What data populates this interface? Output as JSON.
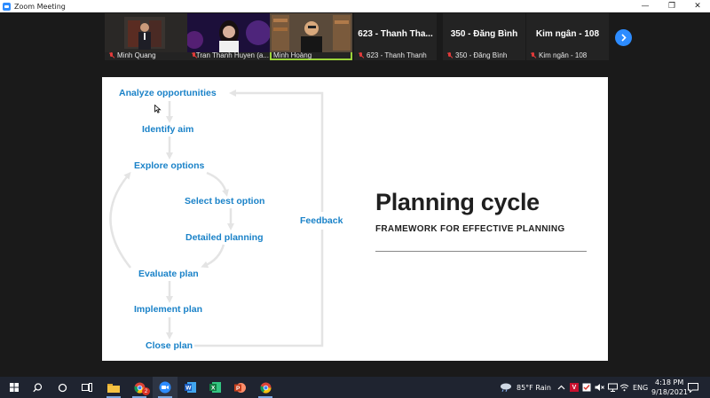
{
  "window": {
    "title": "Zoom Meeting",
    "minimize_glyph": "—",
    "maximize_glyph": "❐",
    "close_glyph": "✕"
  },
  "participants": [
    {
      "name": "Minh Quang",
      "muted": true
    },
    {
      "name": "Tran Thanh Huyen (a...",
      "muted": true
    },
    {
      "name": "Minh Hoàng",
      "muted": false,
      "active_speaker": true
    },
    {
      "name": "623 - Thanh Thanh",
      "muted": true,
      "display": "623 - Thanh Tha..."
    },
    {
      "name": "350 - Đăng Bình",
      "muted": true,
      "display": "350 - Đăng Bình"
    },
    {
      "name": "Kim ngân - 108",
      "muted": true,
      "display": "Kim ngân - 108"
    }
  ],
  "slide": {
    "title": "Planning cycle",
    "subtitle": "FRAMEWORK FOR EFFECTIVE PLANNING",
    "steps": [
      "Analyze opportunities",
      "Identify aim",
      "Explore options",
      "Select best option",
      "Detailed planning",
      "Evaluate plan",
      "Implement plan",
      "Close plan"
    ],
    "feedback_label": "Feedback"
  },
  "taskbar": {
    "weather": "85°F  Rain",
    "language": "ENG",
    "time": "4:18 PM",
    "date": "9/18/2021",
    "chrome_badge": "2"
  },
  "colors": {
    "step_text": "#1a82c8",
    "zoom_blue": "#2d8cff",
    "active_speaker": "#9bd33a",
    "taskbar_bg": "#1f2430"
  }
}
